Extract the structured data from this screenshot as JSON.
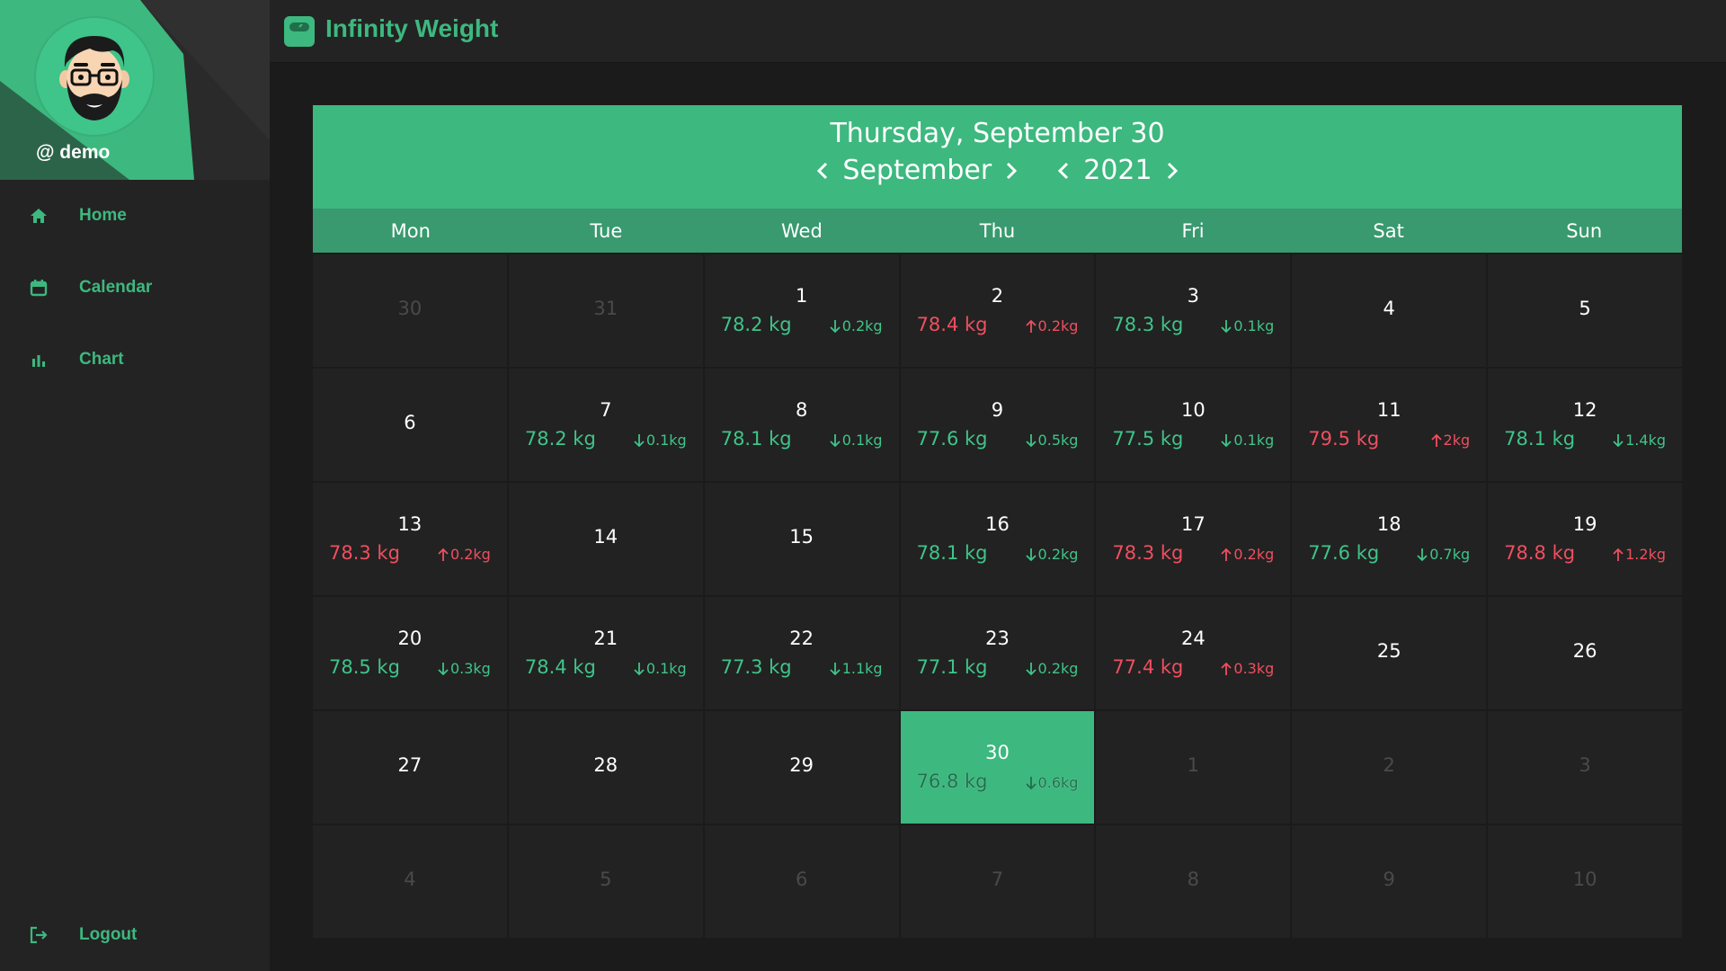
{
  "app": {
    "title": "Infinity Weight"
  },
  "user": {
    "username": "@ demo"
  },
  "nav": {
    "items": [
      {
        "label": "Home",
        "icon": "home-icon"
      },
      {
        "label": "Calendar",
        "icon": "calendar-icon"
      },
      {
        "label": "Chart",
        "icon": "bar-chart-icon"
      }
    ],
    "logout": {
      "label": "Logout",
      "icon": "logout-icon"
    }
  },
  "calendar": {
    "selected_date": "Thursday, September 30",
    "month": "September",
    "year": "2021",
    "weekdays": [
      "Mon",
      "Tue",
      "Wed",
      "Thu",
      "Fri",
      "Sat",
      "Sun"
    ],
    "days": [
      {
        "day": "30",
        "muted": true
      },
      {
        "day": "31",
        "muted": true
      },
      {
        "day": "1",
        "weight": "78.2 kg",
        "delta": "0.2kg",
        "dir": "down"
      },
      {
        "day": "2",
        "weight": "78.4 kg",
        "delta": "0.2kg",
        "dir": "up"
      },
      {
        "day": "3",
        "weight": "78.3 kg",
        "delta": "0.1kg",
        "dir": "down"
      },
      {
        "day": "4"
      },
      {
        "day": "5"
      },
      {
        "day": "6"
      },
      {
        "day": "7",
        "weight": "78.2 kg",
        "delta": "0.1kg",
        "dir": "down"
      },
      {
        "day": "8",
        "weight": "78.1 kg",
        "delta": "0.1kg",
        "dir": "down"
      },
      {
        "day": "9",
        "weight": "77.6 kg",
        "delta": "0.5kg",
        "dir": "down"
      },
      {
        "day": "10",
        "weight": "77.5 kg",
        "delta": "0.1kg",
        "dir": "down"
      },
      {
        "day": "11",
        "weight": "79.5 kg",
        "delta": "2kg",
        "dir": "up"
      },
      {
        "day": "12",
        "weight": "78.1 kg",
        "delta": "1.4kg",
        "dir": "down"
      },
      {
        "day": "13",
        "weight": "78.3 kg",
        "delta": "0.2kg",
        "dir": "up"
      },
      {
        "day": "14"
      },
      {
        "day": "15"
      },
      {
        "day": "16",
        "weight": "78.1 kg",
        "delta": "0.2kg",
        "dir": "down"
      },
      {
        "day": "17",
        "weight": "78.3 kg",
        "delta": "0.2kg",
        "dir": "up"
      },
      {
        "day": "18",
        "weight": "77.6 kg",
        "delta": "0.7kg",
        "dir": "down"
      },
      {
        "day": "19",
        "weight": "78.8 kg",
        "delta": "1.2kg",
        "dir": "up"
      },
      {
        "day": "20",
        "weight": "78.5 kg",
        "delta": "0.3kg",
        "dir": "down"
      },
      {
        "day": "21",
        "weight": "78.4 kg",
        "delta": "0.1kg",
        "dir": "down"
      },
      {
        "day": "22",
        "weight": "77.3 kg",
        "delta": "1.1kg",
        "dir": "down"
      },
      {
        "day": "23",
        "weight": "77.1 kg",
        "delta": "0.2kg",
        "dir": "down"
      },
      {
        "day": "24",
        "weight": "77.4 kg",
        "delta": "0.3kg",
        "dir": "up"
      },
      {
        "day": "25"
      },
      {
        "day": "26"
      },
      {
        "day": "27"
      },
      {
        "day": "28"
      },
      {
        "day": "29"
      },
      {
        "day": "30",
        "weight": "76.8 kg",
        "delta": "0.6kg",
        "dir": "down",
        "selected": true
      },
      {
        "day": "1",
        "muted": true
      },
      {
        "day": "2",
        "muted": true
      },
      {
        "day": "3",
        "muted": true
      },
      {
        "day": "4",
        "muted": true
      },
      {
        "day": "5",
        "muted": true
      },
      {
        "day": "6",
        "muted": true
      },
      {
        "day": "7",
        "muted": true
      },
      {
        "day": "8",
        "muted": true
      },
      {
        "day": "9",
        "muted": true
      },
      {
        "day": "10",
        "muted": true
      }
    ]
  },
  "colors": {
    "accent": "#3db87f",
    "accent_dark": "#389a6e",
    "down": "#3fc489",
    "up": "#ef4f5f",
    "background": "#1b1b1b",
    "panel": "#232323",
    "cell": "#222222"
  }
}
